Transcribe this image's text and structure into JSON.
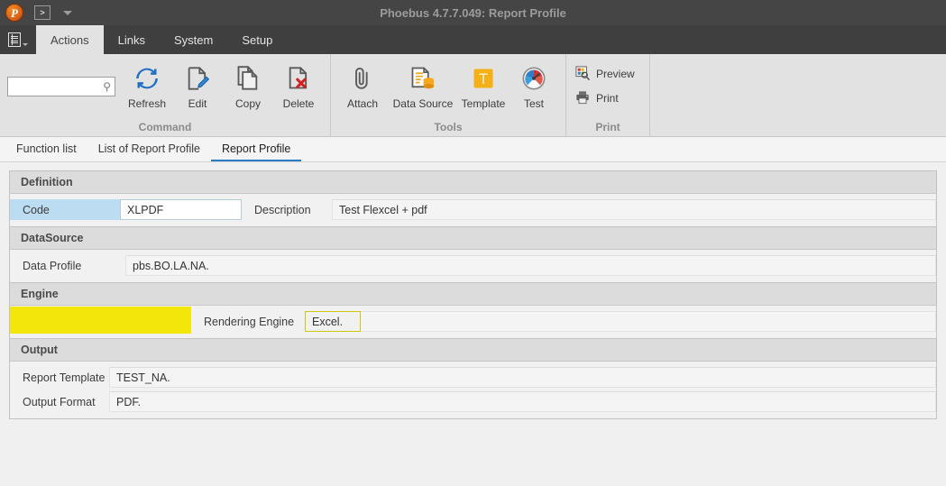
{
  "window": {
    "title": "Phoebus 4.7.7.049: Report Profile",
    "logo_letter": "P",
    "quick_access_button": ">",
    "quick_access_caret": "quick-access-caret"
  },
  "menubar": {
    "items": [
      {
        "label": "Actions",
        "active": true
      },
      {
        "label": "Links",
        "active": false
      },
      {
        "label": "System",
        "active": false
      },
      {
        "label": "Setup",
        "active": false
      }
    ]
  },
  "ribbon": {
    "search": {
      "value": "",
      "placeholder": ""
    },
    "groups": [
      {
        "label": "Command",
        "buttons": [
          {
            "label": "Refresh",
            "icon": "refresh-icon"
          },
          {
            "label": "Edit",
            "icon": "edit-icon"
          },
          {
            "label": "Copy",
            "icon": "copy-icon"
          },
          {
            "label": "Delete",
            "icon": "delete-icon"
          }
        ]
      },
      {
        "label": "Tools",
        "buttons": [
          {
            "label": "Attach",
            "icon": "attach-icon"
          },
          {
            "label": "Data Source",
            "icon": "data-source-icon"
          },
          {
            "label": "Template",
            "icon": "template-icon"
          },
          {
            "label": "Test",
            "icon": "test-icon"
          }
        ]
      },
      {
        "label": "Print",
        "buttons": [
          {
            "label": "Preview",
            "icon": "preview-icon"
          },
          {
            "label": "Print",
            "icon": "print-icon"
          }
        ]
      }
    ]
  },
  "tabs": [
    {
      "label": "Function list",
      "active": false
    },
    {
      "label": "List of Report Profile",
      "active": false
    },
    {
      "label": "Report Profile",
      "active": true
    }
  ],
  "sections": {
    "definition": {
      "title": "Definition",
      "code_label": "Code",
      "code_value": "XLPDF",
      "description_label": "Description",
      "description_value": "Test Flexcel + pdf"
    },
    "datasource": {
      "title": "DataSource",
      "data_profile_label": "Data Profile",
      "data_profile_value": "pbs.BO.LA.NA."
    },
    "engine": {
      "title": "Engine",
      "rendering_engine_label": "Rendering Engine",
      "rendering_engine_value": "Excel."
    },
    "output": {
      "title": "Output",
      "report_template_label": "Report Template",
      "report_template_value": "TEST_NA.",
      "output_format_label": "Output Format",
      "output_format_value": "PDF."
    }
  },
  "colors": {
    "titlebar": "#454545",
    "menubar": "#3f3f3f",
    "ribbon": "#e2e2e2",
    "accent_blue": "#2a7ac4",
    "highlight_yellow": "#f2e60a",
    "highlight_blue": "#bcdcf2",
    "logo_orange": "#d9641a"
  }
}
